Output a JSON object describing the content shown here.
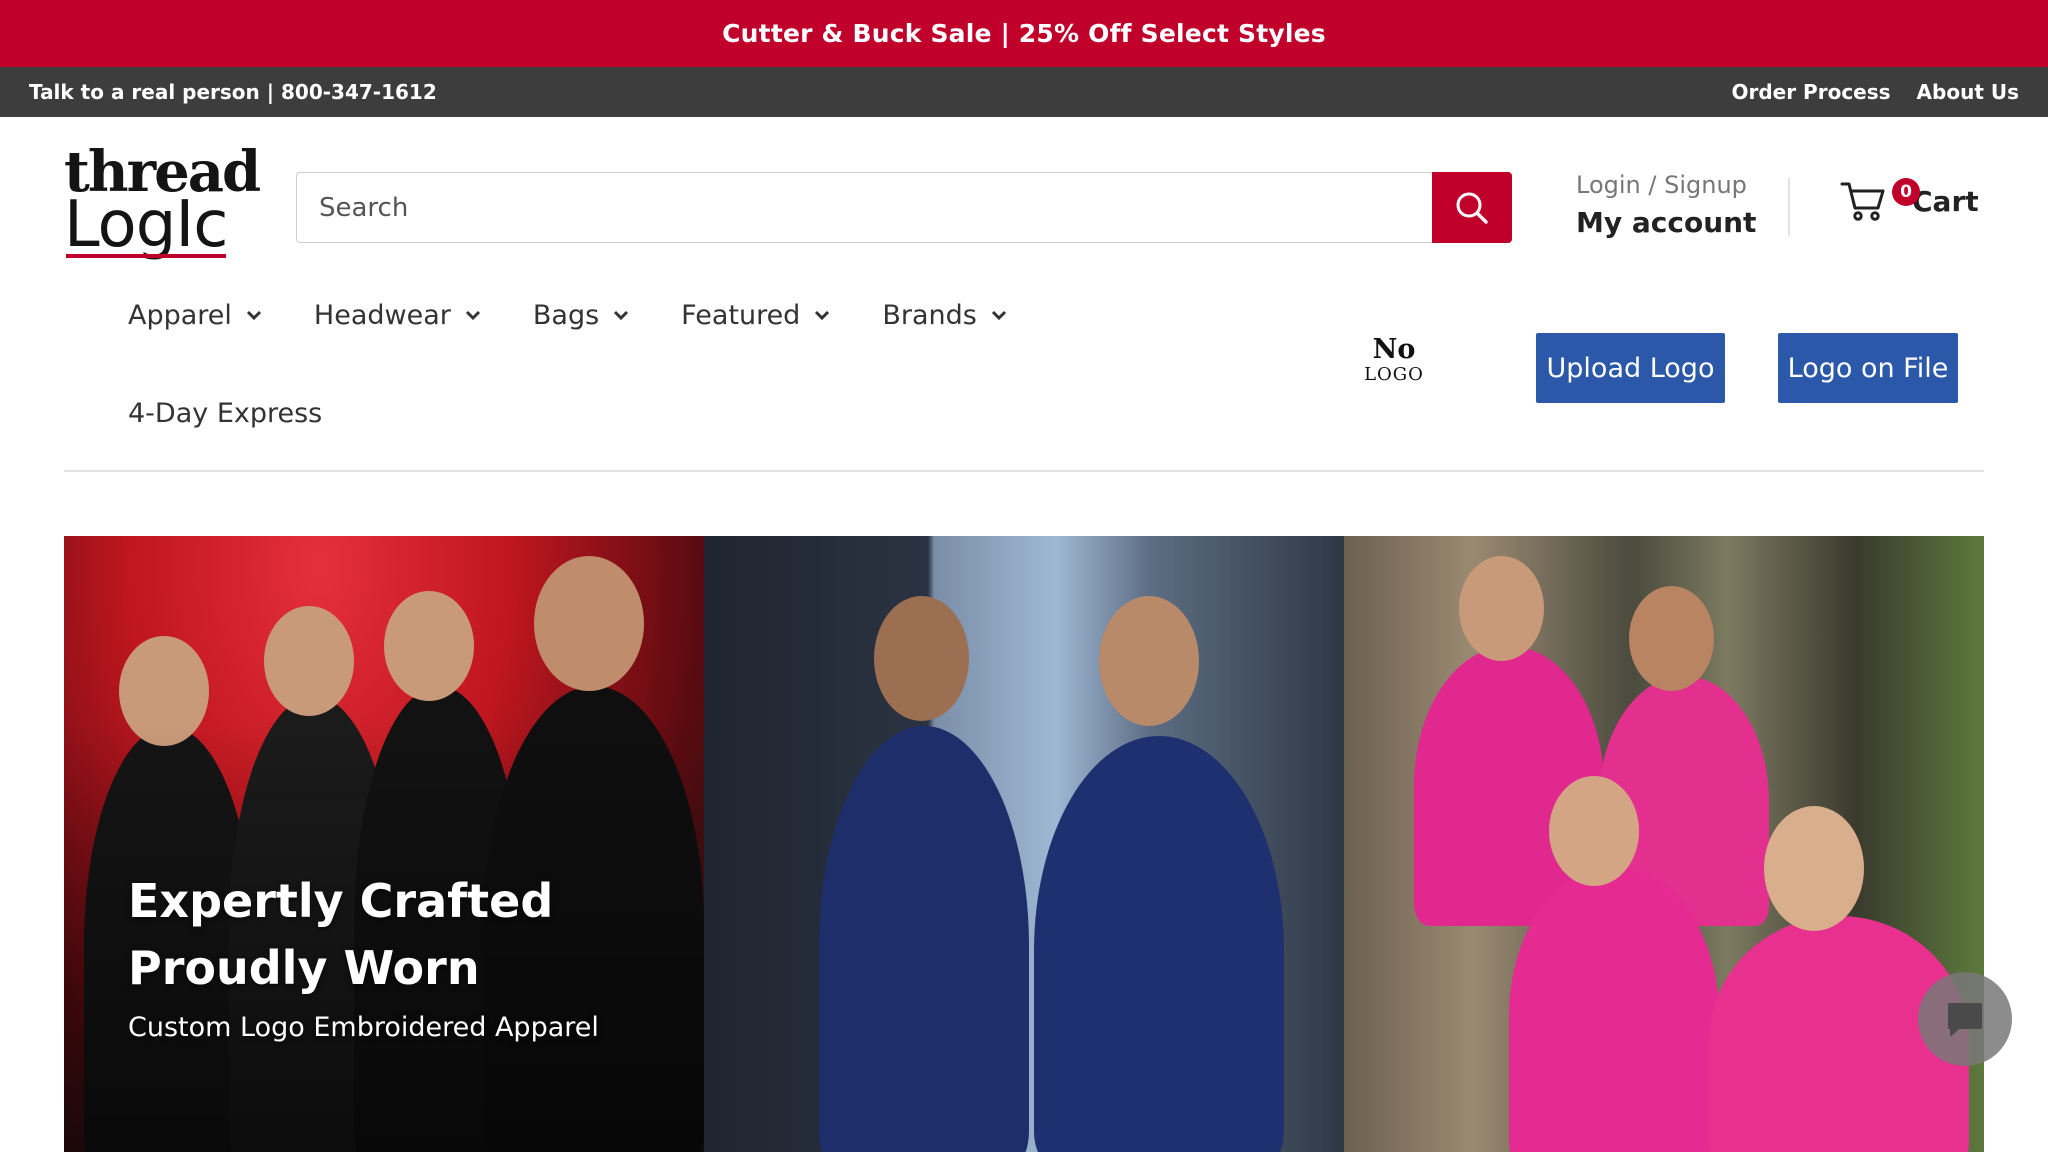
{
  "announcement": {
    "text": "Cutter & Buck Sale | 25% Off Select Styles"
  },
  "topbar": {
    "contact": "Talk to a real person | 800-347-1612",
    "links": [
      "Order Process",
      "About Us"
    ]
  },
  "logo": {
    "line1": "thread",
    "line2": "LogIc"
  },
  "search": {
    "placeholder": "Search"
  },
  "account": {
    "login": "Login / Signup",
    "my_account": "My account"
  },
  "cart": {
    "count": "0",
    "label": "Cart"
  },
  "nav": {
    "items": [
      "Apparel",
      "Headwear",
      "Bags",
      "Featured",
      "Brands"
    ],
    "express": "4-Day Express"
  },
  "logo_status": {
    "line1": "No",
    "line2": "LOGO"
  },
  "buttons": {
    "upload": "Upload Logo",
    "on_file": "Logo on File"
  },
  "hero": {
    "title_line1": "Expertly Crafted",
    "title_line2": "Proudly Worn",
    "subtitle": "Custom Logo Embroidered Apparel"
  },
  "colors": {
    "brand_red": "#c0002a",
    "button_blue": "#2b58a8",
    "topbar_gray": "#3d3d3d"
  }
}
